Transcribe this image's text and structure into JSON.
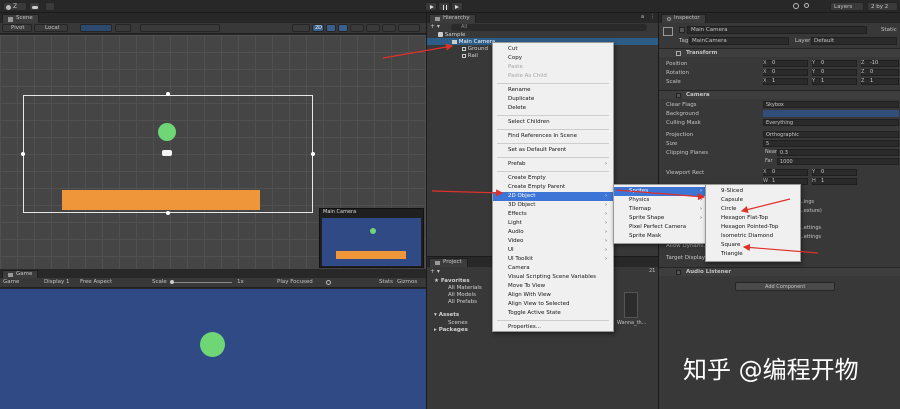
{
  "toolbar": {
    "account_label": "Z",
    "layers_label": "Layers",
    "layout_label": "2 by 2"
  },
  "scene": {
    "tab": "Scene",
    "pivot": "Pivot",
    "local": "Local",
    "mode_2d": "2D"
  },
  "camera_preview": {
    "title": "Main Camera"
  },
  "game": {
    "tab": "Game",
    "display": "Game",
    "display_num": "Display 1",
    "aspect": "Free Aspect",
    "scale_label": "Scale",
    "scale_value": "1x",
    "play_focused": "Play Focused",
    "stats": "Stats",
    "gizmos": "Gizmos"
  },
  "hierarchy": {
    "tab": "Hierarchy",
    "search_placeholder": "All",
    "scene_name": "Sample",
    "items": [
      "Main Camera",
      "Ground",
      "Rail"
    ]
  },
  "project": {
    "tab": "Project",
    "count": "21",
    "favorites": "Favorites",
    "favorites_items": [
      "All Materials",
      "All Models",
      "All Prefabs"
    ],
    "assets": "Assets",
    "assets_items": [
      "Scenes"
    ],
    "packages": "Packages",
    "asset_file": "Wanna_th..."
  },
  "context_menu": {
    "items": [
      {
        "label": "Cut",
        "state": "normal"
      },
      {
        "label": "Copy",
        "state": "normal"
      },
      {
        "label": "Paste",
        "state": "disabled"
      },
      {
        "label": "Paste As Child",
        "state": "disabled"
      },
      {
        "sep": true
      },
      {
        "label": "Rename",
        "state": "normal"
      },
      {
        "label": "Duplicate",
        "state": "normal"
      },
      {
        "label": "Delete",
        "state": "normal"
      },
      {
        "sep": true
      },
      {
        "label": "Select Children",
        "state": "normal"
      },
      {
        "sep": true
      },
      {
        "label": "Find References In Scene",
        "state": "normal"
      },
      {
        "sep": true
      },
      {
        "label": "Set as Default Parent",
        "state": "normal"
      },
      {
        "sep": true
      },
      {
        "label": "Prefab",
        "state": "normal",
        "sub": true
      },
      {
        "sep": true
      },
      {
        "label": "Create Empty",
        "state": "normal"
      },
      {
        "label": "Create Empty Parent",
        "state": "normal"
      },
      {
        "label": "2D Object",
        "state": "highlight",
        "sub": true
      },
      {
        "label": "3D Object",
        "state": "normal",
        "sub": true
      },
      {
        "label": "Effects",
        "state": "normal",
        "sub": true
      },
      {
        "label": "Light",
        "state": "normal",
        "sub": true
      },
      {
        "label": "Audio",
        "state": "normal",
        "sub": true
      },
      {
        "label": "Video",
        "state": "normal",
        "sub": true
      },
      {
        "label": "UI",
        "state": "normal",
        "sub": true
      },
      {
        "label": "UI Toolkit",
        "state": "normal",
        "sub": true
      },
      {
        "label": "Camera",
        "state": "normal"
      },
      {
        "label": "Visual Scripting Scene Variables",
        "state": "normal"
      },
      {
        "label": "Move To View",
        "state": "normal"
      },
      {
        "label": "Align With View",
        "state": "normal"
      },
      {
        "label": "Align View to Selected",
        "state": "normal"
      },
      {
        "label": "Toggle Active State",
        "state": "normal"
      },
      {
        "sep": true
      },
      {
        "label": "Properties...",
        "state": "normal"
      }
    ]
  },
  "submenu_2d": {
    "items": [
      {
        "label": "Sprites",
        "state": "highlight",
        "sub": true
      },
      {
        "label": "Physics",
        "state": "normal",
        "sub": true
      },
      {
        "label": "Tilemap",
        "state": "normal",
        "sub": true
      },
      {
        "label": "Sprite Shape",
        "state": "normal",
        "sub": true
      },
      {
        "label": "Pixel Perfect Camera",
        "state": "normal"
      },
      {
        "label": "Sprite Mask",
        "state": "normal"
      }
    ]
  },
  "submenu_sprites": {
    "items": [
      {
        "label": "9-Sliced"
      },
      {
        "label": "Capsule"
      },
      {
        "label": "Circle"
      },
      {
        "label": "Hexagon Flat-Top"
      },
      {
        "label": "Hexagon Pointed-Top"
      },
      {
        "label": "Isometric Diamond"
      },
      {
        "label": "Square"
      },
      {
        "label": "Triangle"
      }
    ]
  },
  "inspector": {
    "tab": "Inspector",
    "object_name": "Main Camera",
    "static_label": "Static",
    "tag_label": "Tag",
    "tag_value": "MainCamera",
    "layer_label": "Layer",
    "layer_value": "Default",
    "transform_title": "Transform",
    "position_label": "Position",
    "rotation_label": "Rotation",
    "scale_label": "Scale",
    "position": {
      "x": "0",
      "y": "0",
      "z": "-10"
    },
    "rotation": {
      "x": "0",
      "y": "0",
      "z": "0"
    },
    "scale": {
      "x": "1",
      "y": "1",
      "z": "1"
    },
    "camera_title": "Camera",
    "clear_flags_label": "Clear Flags",
    "clear_flags_value": "Skybox",
    "background_label": "Background",
    "culling_mask_label": "Culling Mask",
    "culling_mask_value": "Everything",
    "projection_label": "Projection",
    "projection_value": "Orthographic",
    "size_label": "Size",
    "size_value": "5",
    "clipping_label": "Clipping Planes",
    "near_label": "Near",
    "near_value": "0.3",
    "far_label": "Far",
    "far_value": "1000",
    "viewport_label": "Viewport Rect",
    "vp_x": "0",
    "vp_y": "0",
    "vp_w": "1",
    "vp_h": "1",
    "partial_1": "...ings",
    "partial_2": "...exture)",
    "partial_3": "...ettings",
    "partial_4": "...ettings",
    "allow_dynamic": "Allow Dynami...",
    "target_display": "Target Display",
    "audio_listener": "Audio Listener",
    "add_component": "Add Component"
  },
  "watermark": "知乎 @编程开物",
  "colors": {
    "arrow": "#e0302a",
    "menu_highlight": "#3d75d6",
    "ground": "#f0963a",
    "ball": "#6fd676",
    "game_bg": "#2f4a85"
  }
}
